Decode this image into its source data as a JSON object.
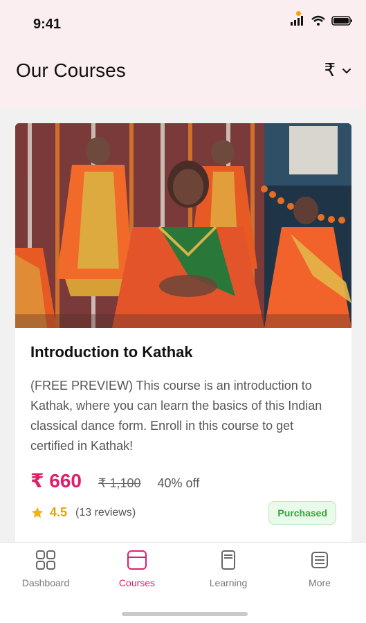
{
  "status": {
    "time": "9:41"
  },
  "header": {
    "title": "Our Courses",
    "currency_symbol": "₹"
  },
  "course": {
    "title": "Introduction to Kathak",
    "description": "(FREE PREVIEW) This course is an introduction to Kathak, where you can learn the basics of this Indian classical dance form. Enroll in this course to get certified in Kathak!",
    "price": "₹ 660",
    "original_price": "₹ 1,100",
    "discount": "40% off",
    "rating": "4.5",
    "reviews": "(13 reviews)",
    "status_badge": "Purchased"
  },
  "tabs": [
    {
      "label": "Dashboard",
      "icon": "grid-icon"
    },
    {
      "label": "Courses",
      "icon": "courses-icon"
    },
    {
      "label": "Learning",
      "icon": "book-icon"
    },
    {
      "label": "More",
      "icon": "menu-icon"
    }
  ],
  "colors": {
    "accent": "#e01e6a",
    "header_bg": "#fbeef1",
    "rating": "#e0a500",
    "badge_text": "#2fa83a",
    "badge_bg": "#e9f9ea"
  }
}
